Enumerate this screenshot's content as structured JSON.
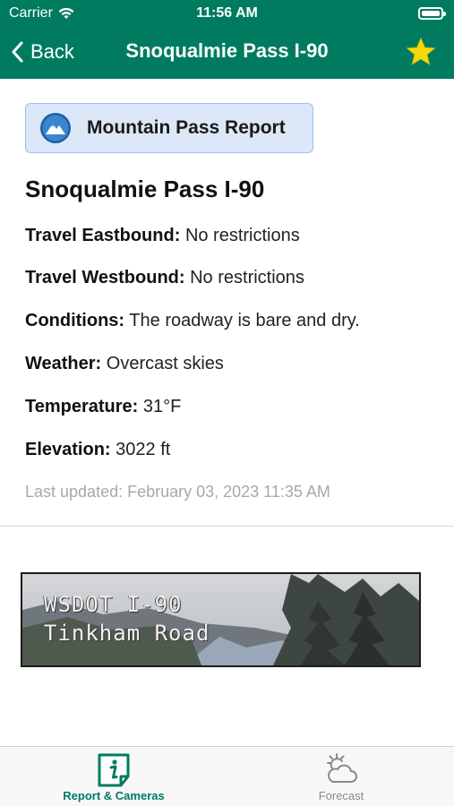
{
  "status_bar": {
    "carrier": "Carrier",
    "time": "11:56 AM"
  },
  "nav": {
    "back_label": "Back",
    "title": "Snoqualmie Pass I-90",
    "favorite_icon": "star-icon",
    "favorite_color": "#f5d90a"
  },
  "report_button": {
    "label": "Mountain Pass Report",
    "icon": "mountain-icon"
  },
  "pass": {
    "name": "Snoqualmie Pass I-90",
    "rows": [
      {
        "label": "Travel Eastbound:",
        "value": "No restrictions"
      },
      {
        "label": "Travel Westbound:",
        "value": "No restrictions"
      },
      {
        "label": "Conditions:",
        "value": "The roadway is bare and dry."
      },
      {
        "label": "Weather:",
        "value": "Overcast skies"
      },
      {
        "label": "Temperature:",
        "value": "31°F"
      },
      {
        "label": "Elevation:",
        "value": "3022 ft"
      }
    ],
    "last_updated": "Last updated: February 03, 2023 11:35 AM"
  },
  "camera": {
    "line1": "WSDOT   I-90",
    "line2": "Tinkham Road"
  },
  "tabs": [
    {
      "label": "Report & Cameras",
      "icon": "info-tab-icon",
      "active": true
    },
    {
      "label": "Forecast",
      "icon": "weather-cloud-sun-icon",
      "active": false
    }
  ],
  "colors": {
    "brand_green": "#007b5f",
    "button_bg": "#dce8f7",
    "muted_text": "#a8a8a8"
  }
}
